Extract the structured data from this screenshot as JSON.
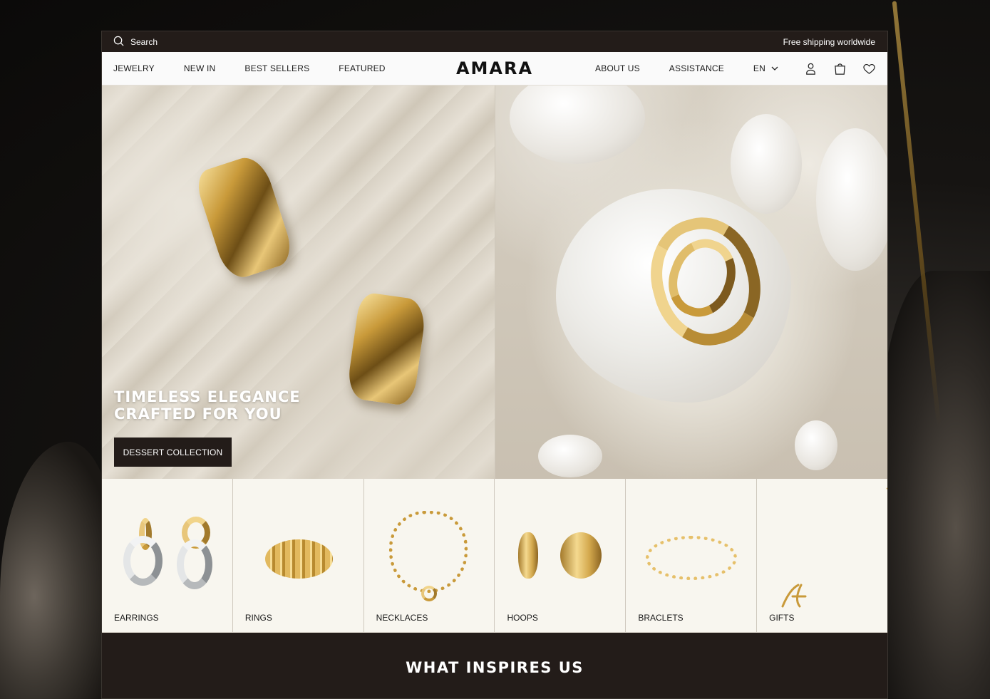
{
  "topbar": {
    "search_label": "Search",
    "promo": "Free shipping worldwide"
  },
  "nav": {
    "left": [
      "JEWELRY",
      "NEW IN",
      "BEST SELLERS",
      "FEATURED"
    ],
    "logo": "AMARA",
    "right": [
      "ABOUT US",
      "ASSISTANCE"
    ],
    "language": "EN",
    "icons": [
      "user-icon",
      "bag-icon",
      "heart-icon"
    ]
  },
  "hero": {
    "headline_line1": "TIMELESS ELEGANCE",
    "headline_line2": "CRAFTED FOR YOU",
    "cta": "DESSERT COLLECTION"
  },
  "categories": [
    "EARRINGS",
    "RINGS",
    "NECKLACES",
    "HOOPS",
    "BRACLETS",
    "GIFTS"
  ],
  "section": {
    "title": "WHAT INSPIRES US"
  },
  "colors": {
    "dark": "#231c19",
    "cream": "#f8f6ef",
    "gold": "#c99a3a"
  }
}
